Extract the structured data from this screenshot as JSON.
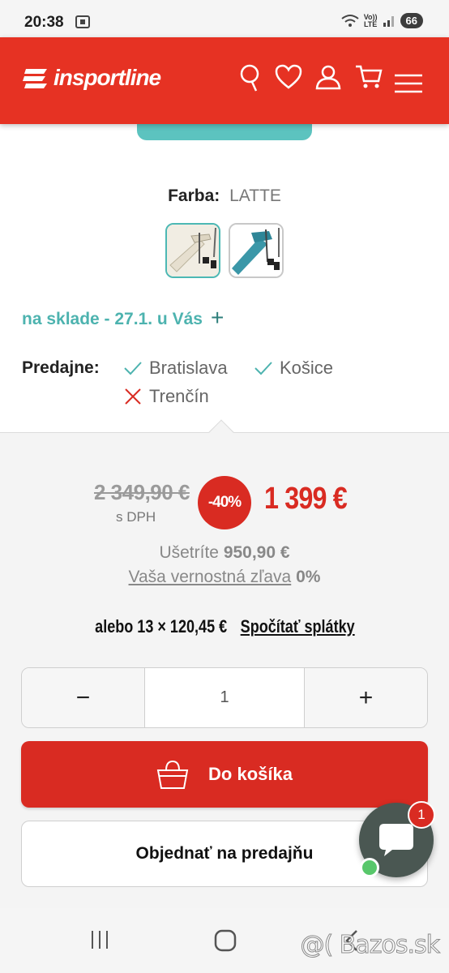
{
  "status_bar": {
    "time": "20:38",
    "network": "LTE",
    "volte": "Vo))",
    "battery": "66"
  },
  "header": {
    "brand": "insportline",
    "colors": {
      "header_bg": "#e63223",
      "accent_red": "#d92b22",
      "teal": "#4db3af"
    },
    "icons": [
      "search-icon",
      "heart-icon",
      "user-icon",
      "cart-icon",
      "menu-icon"
    ]
  },
  "product": {
    "color_label": "Farba:",
    "color_value": "LATTE",
    "swatches": [
      "latte",
      "teal"
    ],
    "stock_text": "na sklade - 27.1. u Vás",
    "stock_expand": "+",
    "stores_label": "Predajne:",
    "stores": [
      {
        "name": "Bratislava",
        "available": true
      },
      {
        "name": "Košice",
        "available": true
      },
      {
        "name": "Trenčín",
        "available": false
      }
    ]
  },
  "pricing": {
    "old_price": "2 349,90 €",
    "vat_note": "s DPH",
    "discount": "-40%",
    "new_price": "1 399 €",
    "savings_label": "Ušetríte",
    "savings_value": "950,90 €",
    "loyalty_label": "Vaša vernostná zľava",
    "loyalty_value": "0%",
    "installments_text": "alebo 13 × 120,45 €",
    "installments_link": "Spočítať splátky"
  },
  "quantity": {
    "minus": "−",
    "value": "1",
    "plus": "+"
  },
  "actions": {
    "add_to_cart": "Do košíka",
    "order_in_store": "Objednať na predajňu"
  },
  "chat": {
    "badge": "1"
  },
  "watermark": {
    "prefix": "@(",
    "text": "Bazos.sk"
  }
}
